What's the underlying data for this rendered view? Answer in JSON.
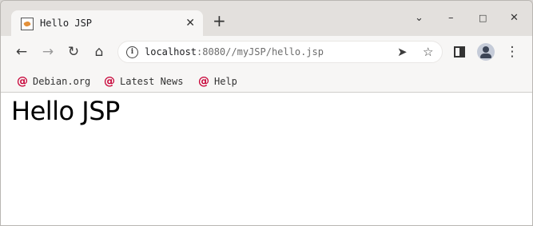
{
  "tab": {
    "title": "Hello JSP",
    "close_glyph": "✕"
  },
  "toolbar": {
    "url_host": "localhost",
    "url_rest": ":8080//myJSP/hello.jsp"
  },
  "bookmarks": [
    {
      "label": "Debian.org",
      "icon": "debian-swirl-icon"
    },
    {
      "label": "Latest News",
      "icon": "debian-swirl-icon"
    },
    {
      "label": "Help",
      "icon": "debian-swirl-icon"
    }
  ],
  "page": {
    "heading": "Hello JSP"
  },
  "colors": {
    "bookmark_icon": "#c70036",
    "page_bg": "#ffffff",
    "toolbar_bg": "#f7f6f5"
  }
}
